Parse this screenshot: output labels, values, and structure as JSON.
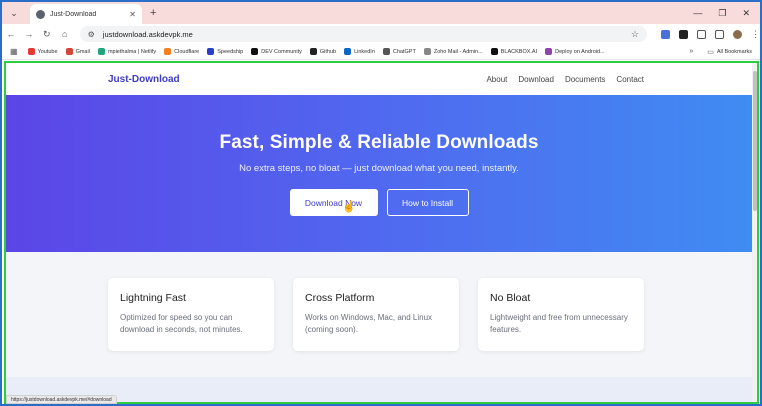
{
  "browser": {
    "tab_title": "Just-Download",
    "url": "justdownload.askdevpk.me",
    "status_url": "https://justdownload.askdevpk.me/#download",
    "bookmarks": [
      {
        "label": "Youtube",
        "color": "#e53935"
      },
      {
        "label": "Gmail",
        "color": "#d44638"
      },
      {
        "label": "mpiethalma | Netlify",
        "color": "#1fa67a"
      },
      {
        "label": "Cloudflare",
        "color": "#f48120"
      },
      {
        "label": "Speedship",
        "color": "#2740c7"
      },
      {
        "label": "DEV Community",
        "color": "#111111"
      },
      {
        "label": "Github",
        "color": "#222222"
      },
      {
        "label": "LinkedIn",
        "color": "#0a66c2"
      },
      {
        "label": "ChatGPT",
        "color": "#555555"
      },
      {
        "label": "Zoho Mail - Admin...",
        "color": "#888888"
      },
      {
        "label": "BLACKBOX.AI",
        "color": "#111111"
      },
      {
        "label": "Deploy on Android...",
        "color": "#8e44ad"
      }
    ],
    "all_bookmarks": "All Bookmarks"
  },
  "site": {
    "brand": "Just-Download",
    "nav": [
      "About",
      "Download",
      "Documents",
      "Contact"
    ]
  },
  "hero": {
    "title": "Fast, Simple & Reliable Downloads",
    "subtitle": "No extra steps, no bloat — just download what you need, instantly.",
    "primary_button": "Download Now",
    "secondary_button": "How to Install"
  },
  "features": [
    {
      "title": "Lightning Fast",
      "text": "Optimized for speed so you can download in seconds, not minutes."
    },
    {
      "title": "Cross Platform",
      "text": "Works on Windows, Mac, and Linux (coming soon)."
    },
    {
      "title": "No Bloat",
      "text": "Lightweight and free from unnecessary features."
    }
  ],
  "colors": {
    "brand": "#3f3bc4",
    "hero_start": "#5b45e6",
    "hero_end": "#3f8cf2",
    "highlight_border": "#2ecc40"
  }
}
